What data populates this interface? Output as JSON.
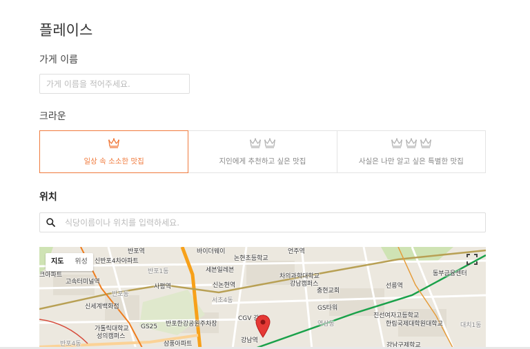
{
  "page": {
    "title": "플레이스"
  },
  "name_field": {
    "label": "가게 이름",
    "placeholder": "가게 이름을 적어주세요.",
    "value": ""
  },
  "crown": {
    "label": "크라운",
    "options": [
      {
        "crowns": 1,
        "text": "일상 속 소소한 맛집",
        "selected": true
      },
      {
        "crowns": 2,
        "text": "지인에게 추천하고 싶은 맛집",
        "selected": false
      },
      {
        "crowns": 3,
        "text": "사실은 나만 알고 싶은 특별한 맛집",
        "selected": false
      }
    ],
    "selected_color": "#f07a3c",
    "unselected_color": "#b5b5b5"
  },
  "location": {
    "label": "위치",
    "search_placeholder": "식당이름이나 위치를 입력하세요.",
    "search_value": ""
  },
  "map": {
    "type_options": [
      "지도",
      "위성"
    ],
    "active_type": "지도",
    "labels": [
      "반포역",
      "바이더웨이",
      "논현초등학교",
      "언주역",
      "신반포4차아파트",
      "반포1동",
      "세븐일레븐",
      "차의과학대학교",
      "강남캠퍼스",
      "크아파트",
      "고속터미널역",
      "사평역",
      "신논현역",
      "선릉역",
      "동부금융센터",
      "반포동",
      "충현교회",
      "서초4동",
      "신세계백화점",
      "GS타워",
      "CGV 강남",
      "진선여자고등학교",
      "한림국제대학원대학교",
      "가톨릭대학교",
      "성의캠퍼스",
      "GS25",
      "반포한강공원주차장",
      "역삼동",
      "대치1동",
      "강남역",
      "반포4동",
      "삼풍아파트",
      "강남구제학교"
    ],
    "colors": {
      "land": "#ece8df",
      "park": "#cfe3b4",
      "road_major": "#f7a11a",
      "subway_line2": "#1aa14a",
      "subway_line9": "#b8a054",
      "pin": "#e53935"
    }
  }
}
